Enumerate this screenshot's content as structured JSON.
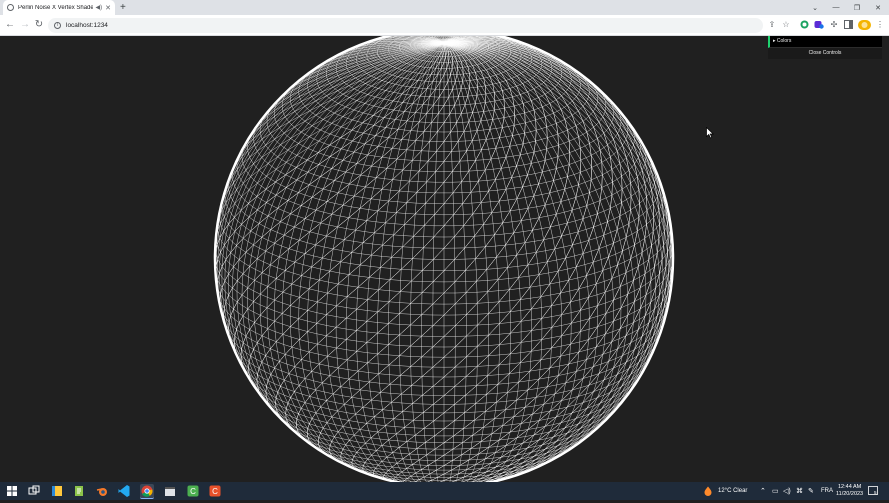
{
  "browser": {
    "tab_title": "Perlin Noise X Vertex Shader",
    "new_tab_symbol": "+",
    "url": "localhost:1234",
    "window_controls": {
      "minimize": "—",
      "restore": "❐",
      "close": "✕"
    },
    "caret": "⌄"
  },
  "gui": {
    "folder_label": "▸ Colors",
    "close_label": "Close Controls",
    "accent": "#1ed36f"
  },
  "scene": {
    "background": "#202020",
    "mesh_color": "#ffffff",
    "object": "wireframe-sphere"
  },
  "taskbar": {
    "weather": "12°C  Clear",
    "language": "FRA",
    "time": "12:44 AM",
    "date": "11/20/2023",
    "notification_count": "5"
  }
}
